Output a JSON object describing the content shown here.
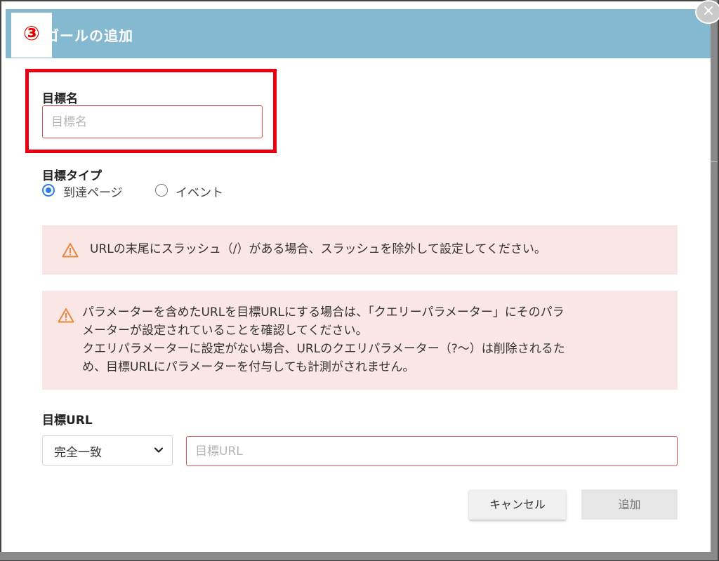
{
  "modal": {
    "title": "ゴールの追加",
    "step_marker": "③",
    "close_glyph": "×"
  },
  "goal_name": {
    "label": "目標名",
    "placeholder": "目標名",
    "value": ""
  },
  "goal_type": {
    "label": "目標タイプ",
    "options": [
      {
        "label": "到達ページ",
        "selected": true
      },
      {
        "label": "イベント",
        "selected": false
      }
    ]
  },
  "alerts": [
    {
      "icon": "warning-icon",
      "lines": [
        "URLの末尾にスラッシュ（/）がある場合、スラッシュを除外して設定してください。"
      ]
    },
    {
      "icon": "warning-icon",
      "lines": [
        "パラメーターを含めたURLを目標URLにする場合は、「クエリーパラメーター」にそのパラ",
        "メーターが設定されていることを確認してください。",
        "クエリパラメーターに設定がない場合、URLのクエリパラメーター（?〜）は削除されるた",
        "め、目標URLにパラメーターを付与しても計測がされません。"
      ]
    }
  ],
  "goal_url": {
    "label": "目標URL",
    "match_type": "完全一致",
    "placeholder": "目標URL",
    "value": ""
  },
  "buttons": {
    "cancel": "キャンセル",
    "add": "追加"
  },
  "colors": {
    "header": "#84b9cf",
    "highlight": "#e60012",
    "alert_bg": "#fbe6e6",
    "warning": "#e8863a",
    "radio": "#2c7be5"
  }
}
